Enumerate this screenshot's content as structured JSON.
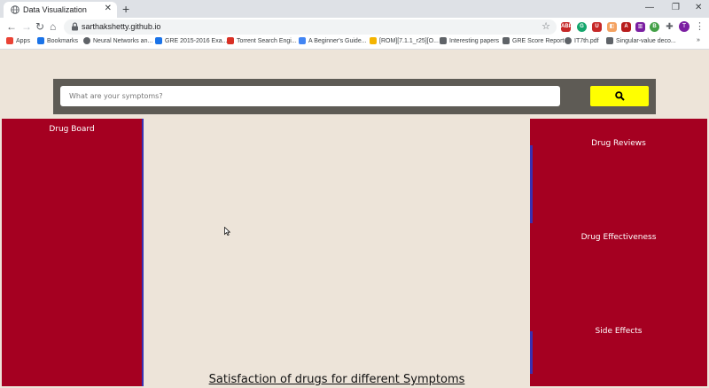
{
  "browser": {
    "tab_title": "Data Visualization",
    "url": "sarthakshetty.github.io",
    "profile_initial": "T",
    "bookmarks": [
      {
        "label": "Apps",
        "icon": "apps-grid-icon",
        "color": "#ea4335"
      },
      {
        "label": "Bookmarks",
        "icon": "star-icon",
        "color": "#1a73e8"
      },
      {
        "label": "Neural Networks an...",
        "icon": "globe-icon",
        "color": "#5f6368"
      },
      {
        "label": "GRE 2015-2016 Exa...",
        "icon": "doc-icon",
        "color": "#1a73e8"
      },
      {
        "label": "Torrent Search Engi...",
        "icon": "x-icon",
        "color": "#d93025"
      },
      {
        "label": "A Beginner's Guide...",
        "icon": "link-icon",
        "color": "#4285f4"
      },
      {
        "label": "[ROM][7.1.1_r25][O...",
        "icon": "xda-icon",
        "color": "#f4b400"
      },
      {
        "label": "Interesting papers",
        "icon": "paper-icon",
        "color": "#5f6368"
      },
      {
        "label": "GRE Score Report",
        "icon": "ets-icon",
        "color": "#5f6368"
      },
      {
        "label": "IT7th.pdf",
        "icon": "globe-icon",
        "color": "#5f6368"
      },
      {
        "label": "Singular-value deco...",
        "icon": "wiki-icon",
        "color": "#5f6368"
      }
    ]
  },
  "search": {
    "placeholder": "What are your symptoms?"
  },
  "left_panel": {
    "title": "Drug Board"
  },
  "right_panel": {
    "items": [
      {
        "label": "Drug Reviews"
      },
      {
        "label": "Drug Effectiveness"
      },
      {
        "label": "Side Effects"
      }
    ]
  },
  "main": {
    "chart_title": "Satisfaction of drugs for different Symptoms"
  },
  "colors": {
    "page_bg": "#ede4d9",
    "panel": "#a50021",
    "search_bar": "#5e5b55",
    "search_button": "#ffff00",
    "accent": "#3a2fb0"
  }
}
